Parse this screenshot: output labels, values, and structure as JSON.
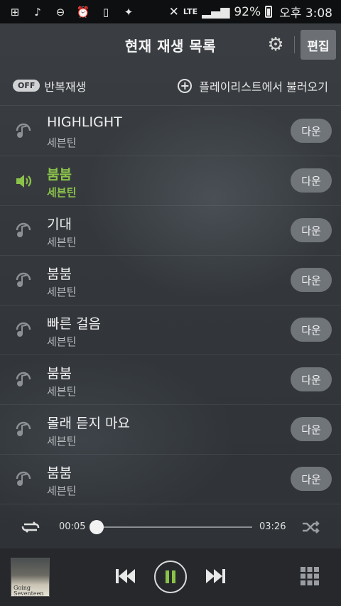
{
  "status_bar": {
    "battery": "92%",
    "time": "오후 3:08",
    "network": "LTE"
  },
  "header": {
    "title": "현재 재생 목록",
    "edit_label": "편집"
  },
  "options": {
    "repeat_state": "OFF",
    "repeat_label": "반복재생",
    "load_label": "플레이리스트에서 불러오기"
  },
  "tracks": [
    {
      "title": "HIGHLIGHT",
      "artist": "세븐틴",
      "download": "다운",
      "playing": false
    },
    {
      "title": "붐붐",
      "artist": "세븐틴",
      "download": "다운",
      "playing": true
    },
    {
      "title": "기대",
      "artist": "세븐틴",
      "download": "다운",
      "playing": false
    },
    {
      "title": "붐붐",
      "artist": "세븐틴",
      "download": "다운",
      "playing": false
    },
    {
      "title": "빠른 걸음",
      "artist": "세븐틴",
      "download": "다운",
      "playing": false
    },
    {
      "title": "붐붐",
      "artist": "세븐틴",
      "download": "다운",
      "playing": false
    },
    {
      "title": "몰래 듣지 마요",
      "artist": "세븐틴",
      "download": "다운",
      "playing": false
    },
    {
      "title": "붐붐",
      "artist": "세븐틴",
      "download": "다운",
      "playing": false
    }
  ],
  "progress": {
    "current": "00:05",
    "total": "03:26",
    "fraction": 0.02
  },
  "player": {
    "album_line1": "Going",
    "album_line2": "Seventeen"
  },
  "colors": {
    "accent": "#8bc34a",
    "download_button": "#70757a"
  }
}
